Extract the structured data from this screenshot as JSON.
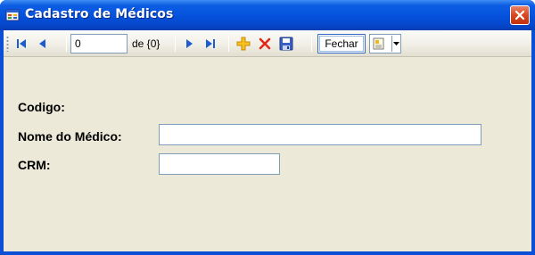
{
  "window": {
    "title": "Cadastro de Médicos"
  },
  "navigator": {
    "position_value": "0",
    "count_label": "de {0}",
    "fechar_label": "Fechar",
    "icons": [
      "move-first-icon",
      "move-previous-icon",
      "move-next-icon",
      "move-last-icon",
      "add-new-icon",
      "delete-icon",
      "save-icon",
      "dropdown-icon"
    ]
  },
  "form": {
    "codigo_label": "Codigo:",
    "nome_label": "Nome do Médico:",
    "nome_value": "",
    "crm_label": "CRM:",
    "crm_value": ""
  },
  "colors": {
    "titlebar": "#0551dc",
    "client_bg": "#ece9d8",
    "close_button": "#d9461f",
    "input_border": "#7f9db9"
  }
}
